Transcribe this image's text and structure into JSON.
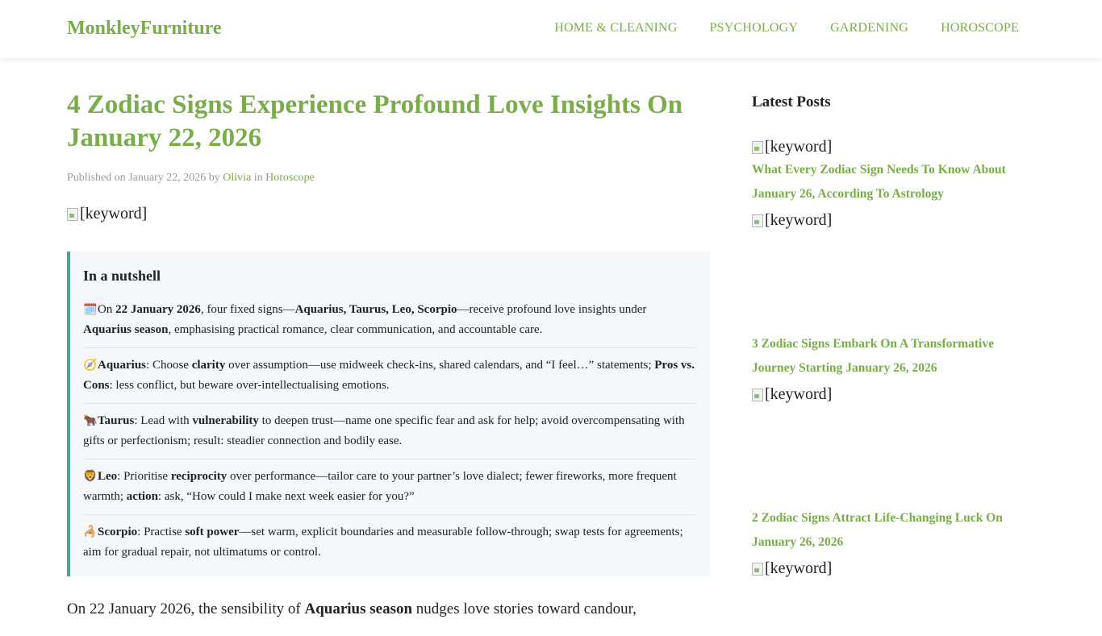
{
  "header": {
    "brand": "MonkleyFurniture",
    "nav": [
      "HOME & CLEANING",
      "PSYCHOLOGY",
      "GARDENING",
      "HOROSCOPE"
    ]
  },
  "article": {
    "title": "4 Zodiac Signs Experience Profound Love Insights On January 22, 2026",
    "meta": {
      "published_prefix": "Published on January 22, 2026 by ",
      "author": "Olivia",
      "in_text": " in ",
      "category": "Horoscope"
    },
    "hero_alt": "[keyword]",
    "nutshell": {
      "heading": "In a nutshell",
      "items": [
        {
          "emoji": "🗓️",
          "parts": [
            [
              "On ",
              false
            ],
            [
              "22 January 2026",
              true
            ],
            [
              ", four fixed signs—",
              false
            ],
            [
              "Aquarius, Taurus, Leo, Scorpio",
              true
            ],
            [
              "—receive profound love insights under ",
              false
            ],
            [
              "Aquarius season",
              true
            ],
            [
              ", emphasising practical romance, clear communication, and accountable care.",
              false
            ]
          ]
        },
        {
          "emoji": "🧭",
          "parts": [
            [
              "Aquarius",
              true
            ],
            [
              ": Choose ",
              false
            ],
            [
              "clarity",
              true
            ],
            [
              " over assumption—use midweek check-ins, shared calendars, and “I feel…” statements; ",
              false
            ],
            [
              "Pros vs. Cons",
              true
            ],
            [
              ": less conflict, but beware over-intellectualising emotions.",
              false
            ]
          ]
        },
        {
          "emoji": "🐂",
          "parts": [
            [
              "Taurus",
              true
            ],
            [
              ": Lead with ",
              false
            ],
            [
              "vulnerability",
              true
            ],
            [
              " to deepen trust—name one specific fear and ask for help; avoid overcompensating with gifts or perfectionism; result: steadier connection and bodily ease.",
              false
            ]
          ]
        },
        {
          "emoji": "🦁",
          "parts": [
            [
              "Leo",
              true
            ],
            [
              ": Prioritise ",
              false
            ],
            [
              "reciprocity",
              true
            ],
            [
              " over performance—tailor care to your partner’s love dialect; fewer fireworks, more frequent warmth; ",
              false
            ],
            [
              "action",
              true
            ],
            [
              ": ask, “How could I make next week easier for you?”",
              false
            ]
          ]
        },
        {
          "emoji": "🦂",
          "parts": [
            [
              "Scorpio",
              true
            ],
            [
              ": Practise ",
              false
            ],
            [
              "soft power",
              true
            ],
            [
              "—set warm, explicit boundaries and measurable follow-through; swap tests for agreements; aim for gradual repair, not ultimatums or control.",
              false
            ]
          ]
        }
      ]
    },
    "body_start": {
      "before": "On 22 January 2026, the sensibility of ",
      "bold": "Aquarius season",
      "after": " nudges love stories toward candour,"
    }
  },
  "sidebar": {
    "heading": "Latest Posts",
    "image_alt": "[keyword]",
    "posts": [
      "What Every Zodiac Sign Needs To Know About January 26, According To Astrology",
      "3 Zodiac Signs Embark On A Transformative Journey Starting January 26, 2026",
      "2 Zodiac Signs Attract Life-Changing Luck On January 26, 2026"
    ]
  },
  "colors": {
    "accent": "#7aad4a",
    "nutshell_border": "#4e9d9a",
    "nutshell_bg": "#f5f8fa"
  },
  "icons": [
    "broken-image-icon",
    "calendar-icon",
    "compass-icon",
    "ox-icon",
    "lion-icon",
    "scorpion-icon"
  ]
}
